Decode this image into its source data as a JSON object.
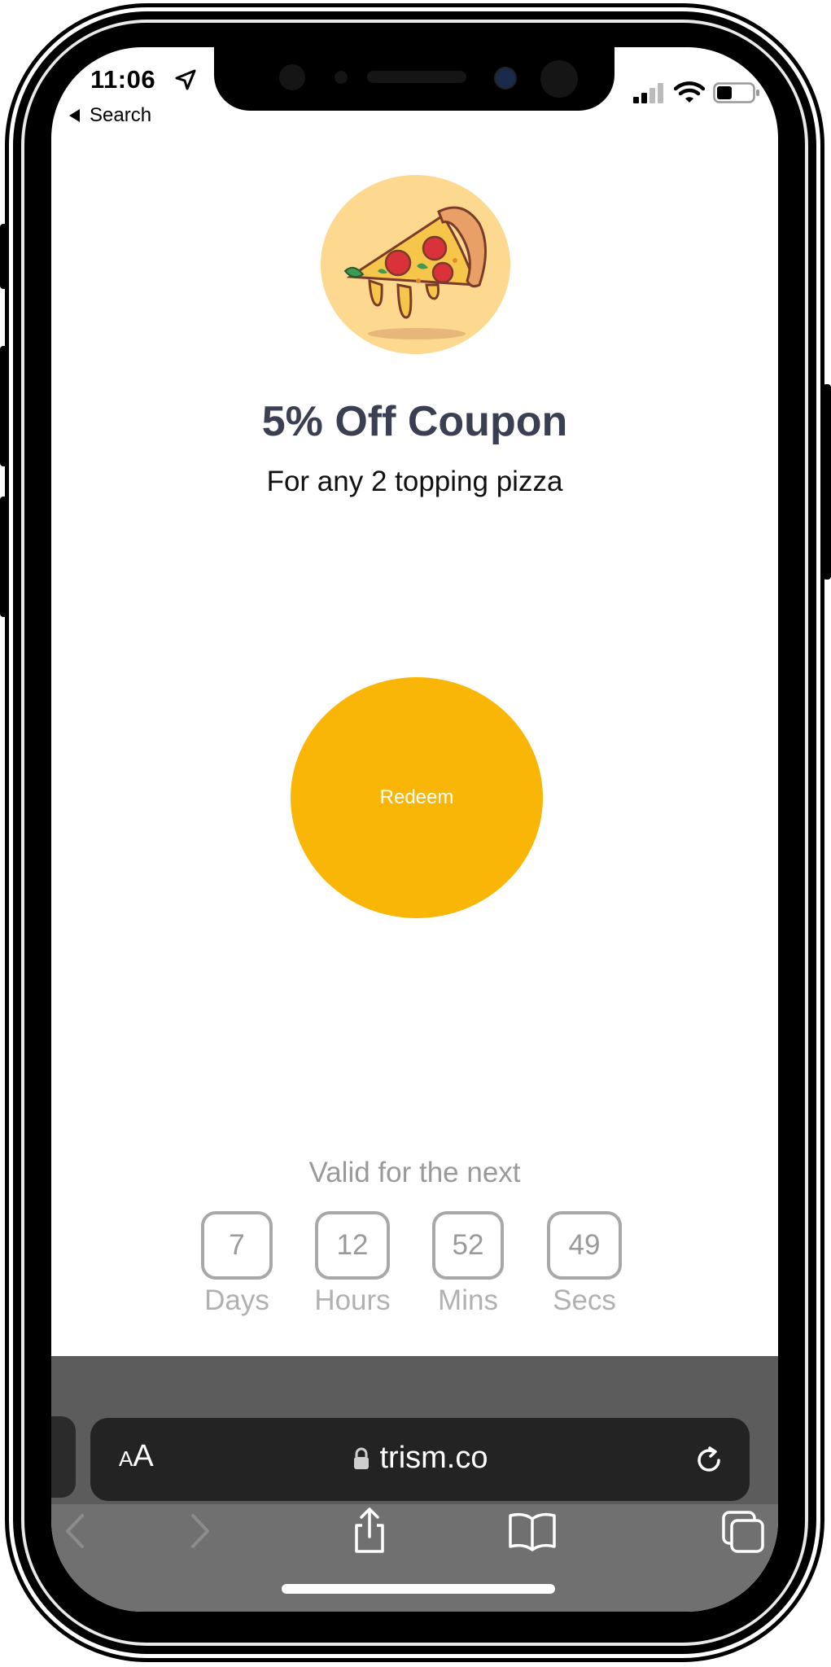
{
  "status_bar": {
    "time": "11:06",
    "back_label": "Search"
  },
  "coupon": {
    "image_icon": "pizza-slice-icon",
    "title": "5% Off Coupon",
    "subtitle": "For any 2 topping pizza",
    "redeem_label": "Redeem"
  },
  "validity": {
    "label": "Valid for the next",
    "timer": [
      {
        "value": "7",
        "unit": "Days"
      },
      {
        "value": "12",
        "unit": "Hours"
      },
      {
        "value": "52",
        "unit": "Mins"
      },
      {
        "value": "49",
        "unit": "Secs"
      }
    ]
  },
  "browser": {
    "text_size_label_small": "A",
    "text_size_label_large": "A",
    "url": "trism.co",
    "icons": [
      "lock-icon",
      "reload-icon",
      "back-arrow-icon",
      "forward-arrow-icon",
      "share-icon",
      "bookmarks-icon",
      "tabs-icon"
    ]
  },
  "colors": {
    "accent": "#f9b606",
    "title": "#3b3f52",
    "pizza_background": "#fcd98e",
    "timer_text": "#9a9a9a"
  }
}
